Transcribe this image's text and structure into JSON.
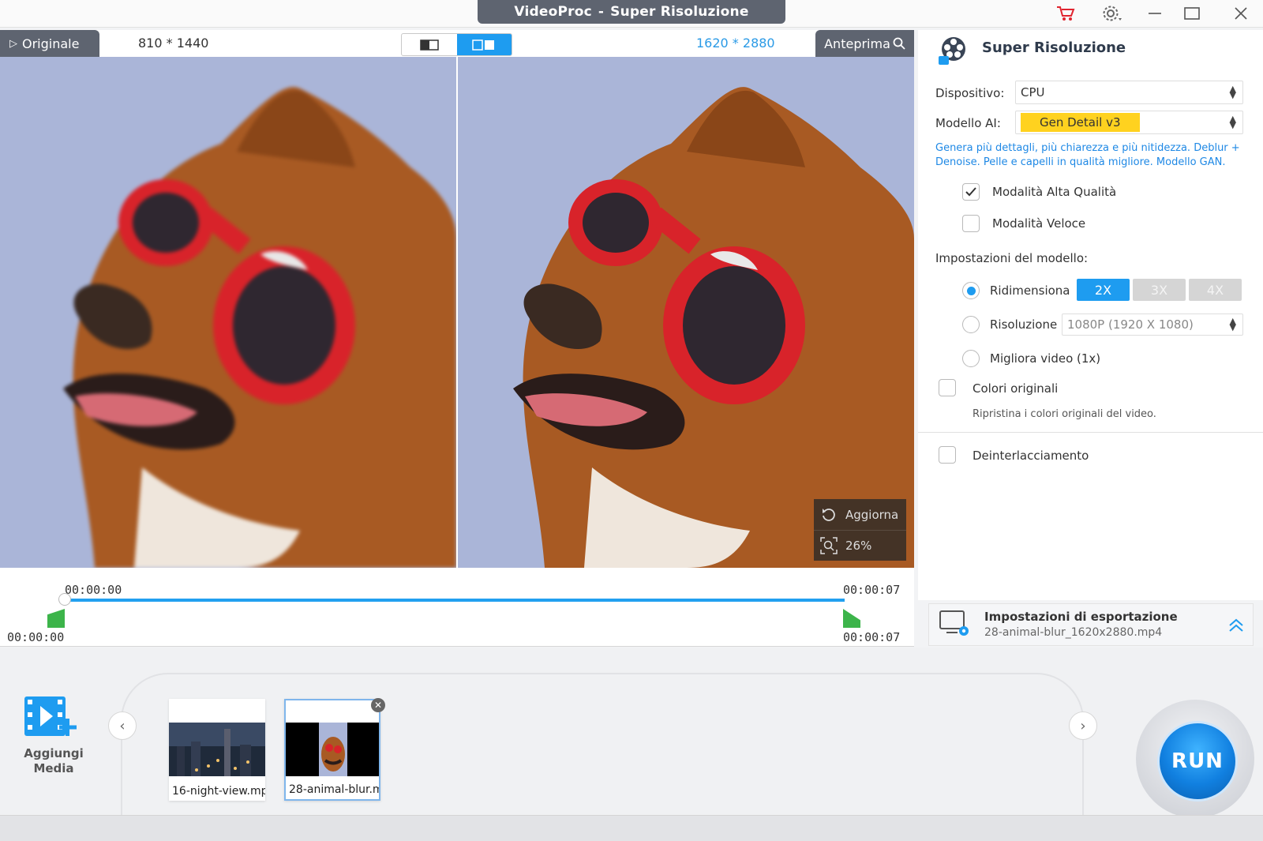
{
  "window": {
    "app_name": "VideoProc",
    "separator": "-",
    "module_title": "Super Risoluzione",
    "icons": [
      "cart-icon",
      "settings-icon",
      "minimize-icon",
      "maximize-icon",
      "close-icon"
    ]
  },
  "preview": {
    "original_tab": "Originale",
    "original_resolution": "810 * 1440",
    "output_resolution": "1620 * 2880",
    "preview_button": "Anteprima",
    "refresh_label": "Aggiorna",
    "zoom_label": "26%"
  },
  "timeline": {
    "start_top": "00:00:00",
    "start_bottom": "00:00:00",
    "end_top": "00:00:07",
    "end_bottom": "00:00:07",
    "progress_fraction": 1.0
  },
  "panel": {
    "title": "Super Risoluzione",
    "device_label": "Dispositivo:",
    "device_value": "CPU",
    "model_label": "Modello AI:",
    "model_value": "Gen Detail v3",
    "model_description": "Genera più dettagli, più chiarezza e più nitidezza. Deblur + Denoise. Pelle e capelli in qualità migliore. Modello GAN.",
    "high_quality_label": "Modalità Alta Qualità",
    "high_quality_checked": true,
    "fast_mode_label": "Modalità Veloce",
    "fast_mode_checked": false,
    "model_settings_label": "Impostazioni del modello:",
    "resize_label": "Ridimensiona",
    "scale_options": [
      "2X",
      "3X",
      "4X"
    ],
    "scale_selected": "2X",
    "resolution_label": "Risoluzione",
    "resolution_value": "1080P (1920 X 1080)",
    "enhance_label": "Migliora video (1x)",
    "original_colors_label": "Colori originali",
    "original_colors_hint": "Ripristina i colori originali del video.",
    "deinterlace_label": "Deinterlacciamento"
  },
  "export": {
    "title": "Impostazioni di esportazione",
    "filename": "28-animal-blur_1620x2880.mp4"
  },
  "media": {
    "add_label_line1": "Aggiungi",
    "add_label_line2": "Media",
    "items": [
      {
        "name": "16-night-view.mp"
      },
      {
        "name": "28-animal-blur.m"
      }
    ]
  },
  "run_label": "RUN",
  "colors": {
    "accent": "#1e9cf0",
    "model_highlight": "#ffd21f",
    "dark_tab": "#5e6470",
    "timeline_green": "#3cb44a"
  }
}
